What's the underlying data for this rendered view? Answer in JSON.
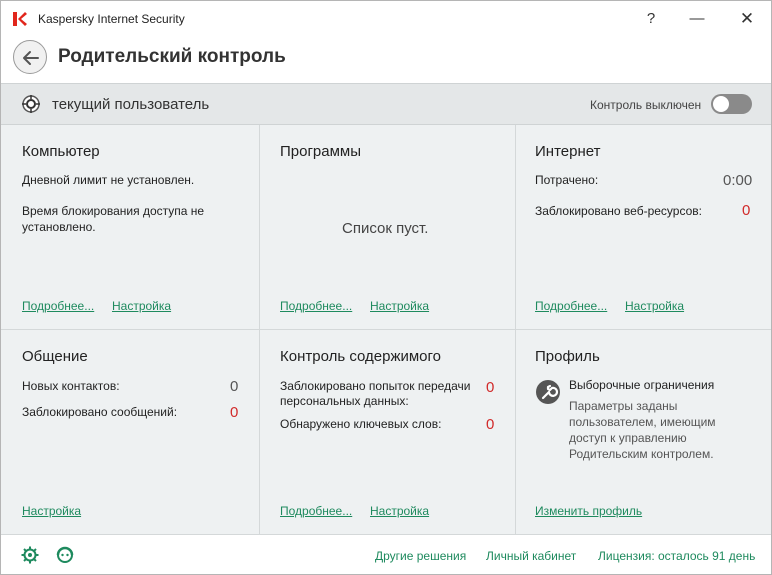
{
  "app": {
    "title": "Kaspersky Internet Security",
    "help": "?",
    "minimize": "—",
    "close": "✕"
  },
  "page": {
    "title": "Родительский контроль"
  },
  "userbar": {
    "user_label": "текущий пользователь",
    "control_status": "Контроль выключен",
    "control_enabled": false
  },
  "tiles": {
    "computer": {
      "title": "Компьютер",
      "line1": "Дневной лимит не установлен.",
      "line2a": "Время блокирования доступа не",
      "line2b": "установлено.",
      "details_link": "Подробнее...",
      "settings_link": "Настройка"
    },
    "programs": {
      "title": "Программы",
      "empty": "Список пуст.",
      "details_link": "Подробнее...",
      "settings_link": "Настройка"
    },
    "internet": {
      "title": "Интернет",
      "spent_label": "Потрачено:",
      "spent_value": "0:00",
      "blocked_label": "Заблокировано веб-ресурсов:",
      "blocked_value": "0",
      "details_link": "Подробнее...",
      "settings_link": "Настройка"
    },
    "communication": {
      "title": "Общение",
      "contacts_label": "Новых контактов:",
      "contacts_value": "0",
      "messages_label": "Заблокировано сообщений:",
      "messages_value": "0",
      "settings_link": "Настройка"
    },
    "content": {
      "title": "Контроль содержимого",
      "transfer_label_a": "Заблокировано попыток передачи",
      "transfer_label_b": "персональных данных:",
      "transfer_value": "0",
      "keywords_label": "Обнаружено ключевых слов:",
      "keywords_value": "0",
      "details_link": "Подробнее...",
      "settings_link": "Настройка"
    },
    "profile": {
      "title": "Профиль",
      "name": "Выборочные ограничения",
      "desc_a": "Параметры заданы",
      "desc_b": "пользователем, имеющим",
      "desc_c": "доступ к управлению",
      "desc_d": "Родительским контролем.",
      "change_link": "Изменить профиль"
    }
  },
  "footer": {
    "other_solutions": "Другие решения",
    "my_account": "Личный кабинет",
    "license": "Лицензия: осталось 91 день"
  },
  "colors": {
    "accent_green": "#1e8a5e",
    "alert_red": "#d12a2a",
    "brand_red": "#e1261c"
  }
}
